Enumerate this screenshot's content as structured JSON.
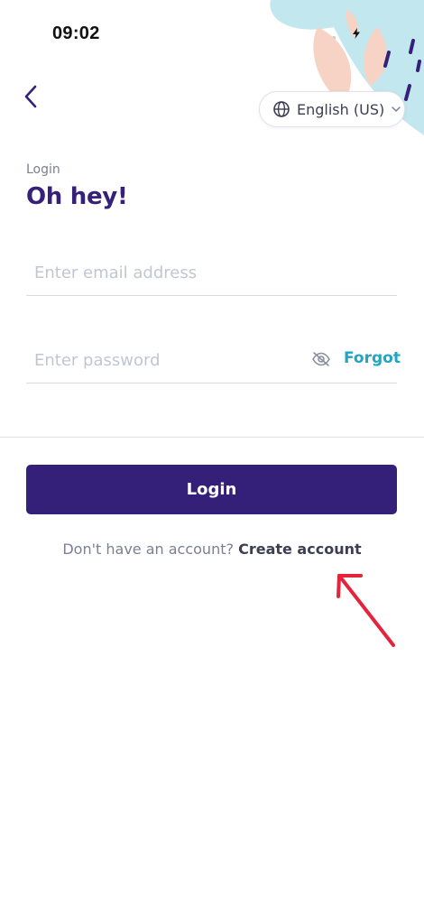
{
  "status_bar": {
    "time": "09:02"
  },
  "header": {
    "language_label": "English (US)"
  },
  "login": {
    "subtitle": "Login",
    "heading": "Oh hey!",
    "email_placeholder": "Enter email address",
    "password_placeholder": "Enter password",
    "forgot_label": "Forgot",
    "login_button": "Login",
    "no_account_text": "Don't have an account?",
    "create_account_label": "Create account"
  },
  "colors": {
    "primary": "#341f79",
    "accent": "#1ea6c4",
    "annotation_arrow": "#e5243b"
  },
  "icons": {
    "back": "chevron-left-icon",
    "language": "globe-icon",
    "dropdown": "chevron-down-icon",
    "password_visibility": "eye-off-icon"
  }
}
